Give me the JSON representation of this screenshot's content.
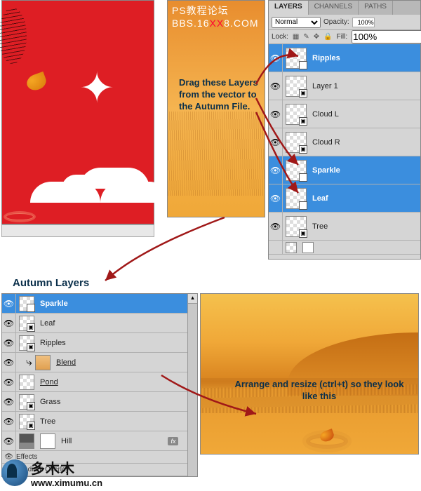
{
  "watermark_top": {
    "line1": "PS教程论坛",
    "line2_a": "BBS.16",
    "line2_b": "XX",
    "line2_c": "8.COM"
  },
  "watermark_bottom": {
    "text1": "多木木",
    "text2": "www.ximumu.cn"
  },
  "top_panel": {
    "tabs": [
      "LAYERS",
      "CHANNELS",
      "PATHS"
    ],
    "blend_mode": "Normal",
    "opacity_label": "Opacity:",
    "opacity_value": "100%",
    "lock_label": "Lock:",
    "fill_label": "Fill:",
    "fill_value": "100%",
    "layers": [
      {
        "name": "Ripples",
        "selected": true
      },
      {
        "name": "Layer 1",
        "selected": false
      },
      {
        "name": "Cloud L",
        "selected": false
      },
      {
        "name": "Cloud R",
        "selected": false
      },
      {
        "name": "Sparkle",
        "selected": true
      },
      {
        "name": "Leaf",
        "selected": true
      },
      {
        "name": "Tree",
        "selected": false
      }
    ]
  },
  "instruction1": "Drag these Layers from the vector to the Autumn File.",
  "heading2": "Autumn Layers",
  "bottom_panel": {
    "layers": [
      {
        "name": "Sparkle",
        "selected": true
      },
      {
        "name": "Leaf"
      },
      {
        "name": "Ripples"
      },
      {
        "name": "Blend",
        "indent": true,
        "underline": true,
        "blend_thumb": true
      },
      {
        "name": "Pond",
        "underline": true
      },
      {
        "name": "Grass"
      },
      {
        "name": "Tree"
      },
      {
        "name": "Hill",
        "fx": true,
        "hill_thumb": true
      }
    ],
    "effects_label": "Effects",
    "gradient_label": "Gradient Overlay",
    "fx_badge": "fx"
  },
  "instruction2": "Arrange and resize (ctrl+t) so they look like this"
}
